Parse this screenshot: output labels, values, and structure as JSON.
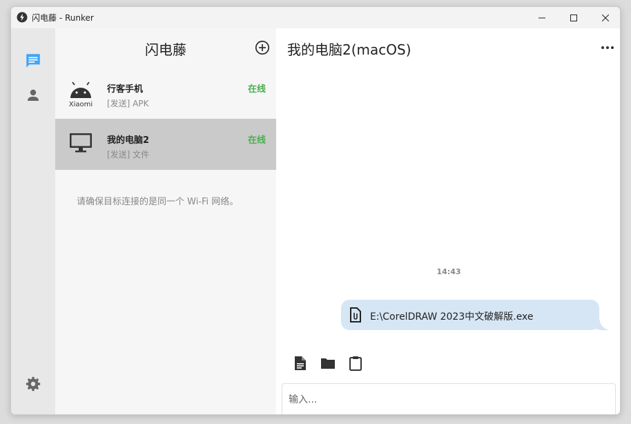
{
  "window": {
    "title": "闪电藤 - Runker"
  },
  "titlebar": {
    "icons": [
      "app-logo-icon",
      "minimize-icon",
      "maximize-icon",
      "close-icon"
    ]
  },
  "rail": {
    "items": [
      "chat-icon",
      "contacts-icon"
    ],
    "bottom": "settings-icon",
    "accent": "#42a5f5"
  },
  "list": {
    "title": "闪电藤",
    "devices": [
      {
        "name": "行客手机",
        "sub": "Xiaomi",
        "status": "在线",
        "last": "[发送] APK",
        "icon": "android-icon"
      },
      {
        "name": "我的电脑2",
        "sub": "",
        "status": "在线",
        "last": "[发送] 文件",
        "icon": "monitor-icon"
      }
    ],
    "hint": "请确保目标连接的是同一个 Wi-Fi 网络。",
    "status_color": "#4caf50"
  },
  "chat": {
    "title": "我的电脑2(macOS)",
    "time": "14:43",
    "message": {
      "text": "E:\\CorelDRAW 2023中文破解版.exe",
      "icon": "attachment-file-icon"
    },
    "toolbar": [
      "document-icon",
      "folder-icon",
      "clipboard-icon"
    ],
    "input_placeholder": "输入..."
  }
}
